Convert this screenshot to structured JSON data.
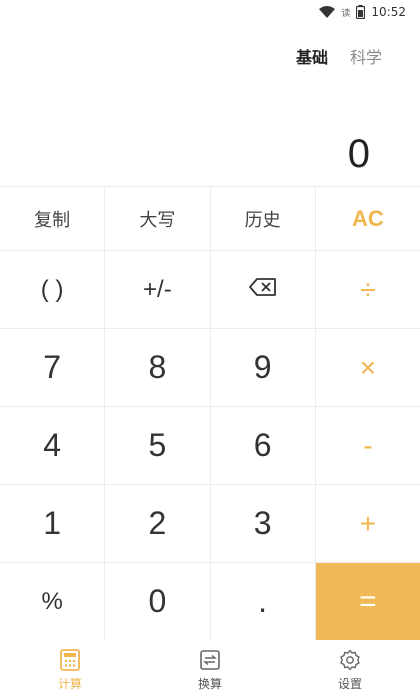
{
  "status_bar": {
    "hd_label": "读",
    "time": "10:52",
    "icons": [
      "wifi-icon",
      "battery-icon"
    ]
  },
  "mode_tabs": [
    {
      "label": "基础",
      "active": true
    },
    {
      "label": "科学",
      "active": false
    }
  ],
  "display": {
    "value": "0"
  },
  "keypad": {
    "copy": "复制",
    "capital": "大写",
    "history": "历史",
    "clear": "AC",
    "parens": "( )",
    "sign": "+/-",
    "divide": "÷",
    "seven": "7",
    "eight": "8",
    "nine": "9",
    "multiply": "×",
    "four": "4",
    "five": "5",
    "six": "6",
    "minus": "-",
    "one": "1",
    "two": "2",
    "three": "3",
    "plus": "+",
    "percent": "%",
    "zero": "0",
    "dot": ".",
    "equals": "="
  },
  "bottom_nav": [
    {
      "label": "计算",
      "icon": "calculator-icon",
      "active": true
    },
    {
      "label": "换算",
      "icon": "convert-icon",
      "active": false
    },
    {
      "label": "设置",
      "icon": "gear-icon",
      "active": false
    }
  ],
  "colors": {
    "accent": "#f0b64d",
    "equals_bg": "#f0b956",
    "divider": "#ececec"
  }
}
